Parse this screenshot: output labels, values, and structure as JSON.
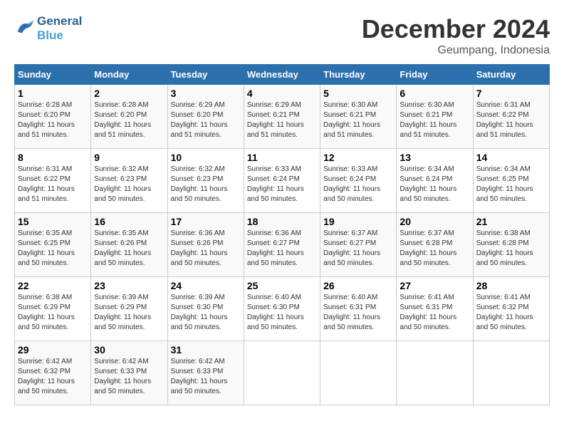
{
  "logo": {
    "line1": "General",
    "line2": "Blue"
  },
  "title": "December 2024",
  "location": "Geumpang, Indonesia",
  "days_header": [
    "Sunday",
    "Monday",
    "Tuesday",
    "Wednesday",
    "Thursday",
    "Friday",
    "Saturday"
  ],
  "weeks": [
    [
      {
        "day": "1",
        "sunrise": "6:28 AM",
        "sunset": "6:20 PM",
        "daylight": "11 hours and 51 minutes."
      },
      {
        "day": "2",
        "sunrise": "6:28 AM",
        "sunset": "6:20 PM",
        "daylight": "11 hours and 51 minutes."
      },
      {
        "day": "3",
        "sunrise": "6:29 AM",
        "sunset": "6:20 PM",
        "daylight": "11 hours and 51 minutes."
      },
      {
        "day": "4",
        "sunrise": "6:29 AM",
        "sunset": "6:21 PM",
        "daylight": "11 hours and 51 minutes."
      },
      {
        "day": "5",
        "sunrise": "6:30 AM",
        "sunset": "6:21 PM",
        "daylight": "11 hours and 51 minutes."
      },
      {
        "day": "6",
        "sunrise": "6:30 AM",
        "sunset": "6:21 PM",
        "daylight": "11 hours and 51 minutes."
      },
      {
        "day": "7",
        "sunrise": "6:31 AM",
        "sunset": "6:22 PM",
        "daylight": "11 hours and 51 minutes."
      }
    ],
    [
      {
        "day": "8",
        "sunrise": "6:31 AM",
        "sunset": "6:22 PM",
        "daylight": "11 hours and 51 minutes."
      },
      {
        "day": "9",
        "sunrise": "6:32 AM",
        "sunset": "6:23 PM",
        "daylight": "11 hours and 50 minutes."
      },
      {
        "day": "10",
        "sunrise": "6:32 AM",
        "sunset": "6:23 PM",
        "daylight": "11 hours and 50 minutes."
      },
      {
        "day": "11",
        "sunrise": "6:33 AM",
        "sunset": "6:24 PM",
        "daylight": "11 hours and 50 minutes."
      },
      {
        "day": "12",
        "sunrise": "6:33 AM",
        "sunset": "6:24 PM",
        "daylight": "11 hours and 50 minutes."
      },
      {
        "day": "13",
        "sunrise": "6:34 AM",
        "sunset": "6:24 PM",
        "daylight": "11 hours and 50 minutes."
      },
      {
        "day": "14",
        "sunrise": "6:34 AM",
        "sunset": "6:25 PM",
        "daylight": "11 hours and 50 minutes."
      }
    ],
    [
      {
        "day": "15",
        "sunrise": "6:35 AM",
        "sunset": "6:25 PM",
        "daylight": "11 hours and 50 minutes."
      },
      {
        "day": "16",
        "sunrise": "6:35 AM",
        "sunset": "6:26 PM",
        "daylight": "11 hours and 50 minutes."
      },
      {
        "day": "17",
        "sunrise": "6:36 AM",
        "sunset": "6:26 PM",
        "daylight": "11 hours and 50 minutes."
      },
      {
        "day": "18",
        "sunrise": "6:36 AM",
        "sunset": "6:27 PM",
        "daylight": "11 hours and 50 minutes."
      },
      {
        "day": "19",
        "sunrise": "6:37 AM",
        "sunset": "6:27 PM",
        "daylight": "11 hours and 50 minutes."
      },
      {
        "day": "20",
        "sunrise": "6:37 AM",
        "sunset": "6:28 PM",
        "daylight": "11 hours and 50 minutes."
      },
      {
        "day": "21",
        "sunrise": "6:38 AM",
        "sunset": "6:28 PM",
        "daylight": "11 hours and 50 minutes."
      }
    ],
    [
      {
        "day": "22",
        "sunrise": "6:38 AM",
        "sunset": "6:29 PM",
        "daylight": "11 hours and 50 minutes."
      },
      {
        "day": "23",
        "sunrise": "6:39 AM",
        "sunset": "6:29 PM",
        "daylight": "11 hours and 50 minutes."
      },
      {
        "day": "24",
        "sunrise": "6:39 AM",
        "sunset": "6:30 PM",
        "daylight": "11 hours and 50 minutes."
      },
      {
        "day": "25",
        "sunrise": "6:40 AM",
        "sunset": "6:30 PM",
        "daylight": "11 hours and 50 minutes."
      },
      {
        "day": "26",
        "sunrise": "6:40 AM",
        "sunset": "6:31 PM",
        "daylight": "11 hours and 50 minutes."
      },
      {
        "day": "27",
        "sunrise": "6:41 AM",
        "sunset": "6:31 PM",
        "daylight": "11 hours and 50 minutes."
      },
      {
        "day": "28",
        "sunrise": "6:41 AM",
        "sunset": "6:32 PM",
        "daylight": "11 hours and 50 minutes."
      }
    ],
    [
      {
        "day": "29",
        "sunrise": "6:42 AM",
        "sunset": "6:32 PM",
        "daylight": "11 hours and 50 minutes."
      },
      {
        "day": "30",
        "sunrise": "6:42 AM",
        "sunset": "6:33 PM",
        "daylight": "11 hours and 50 minutes."
      },
      {
        "day": "31",
        "sunrise": "6:42 AM",
        "sunset": "6:33 PM",
        "daylight": "11 hours and 50 minutes."
      },
      null,
      null,
      null,
      null
    ]
  ]
}
